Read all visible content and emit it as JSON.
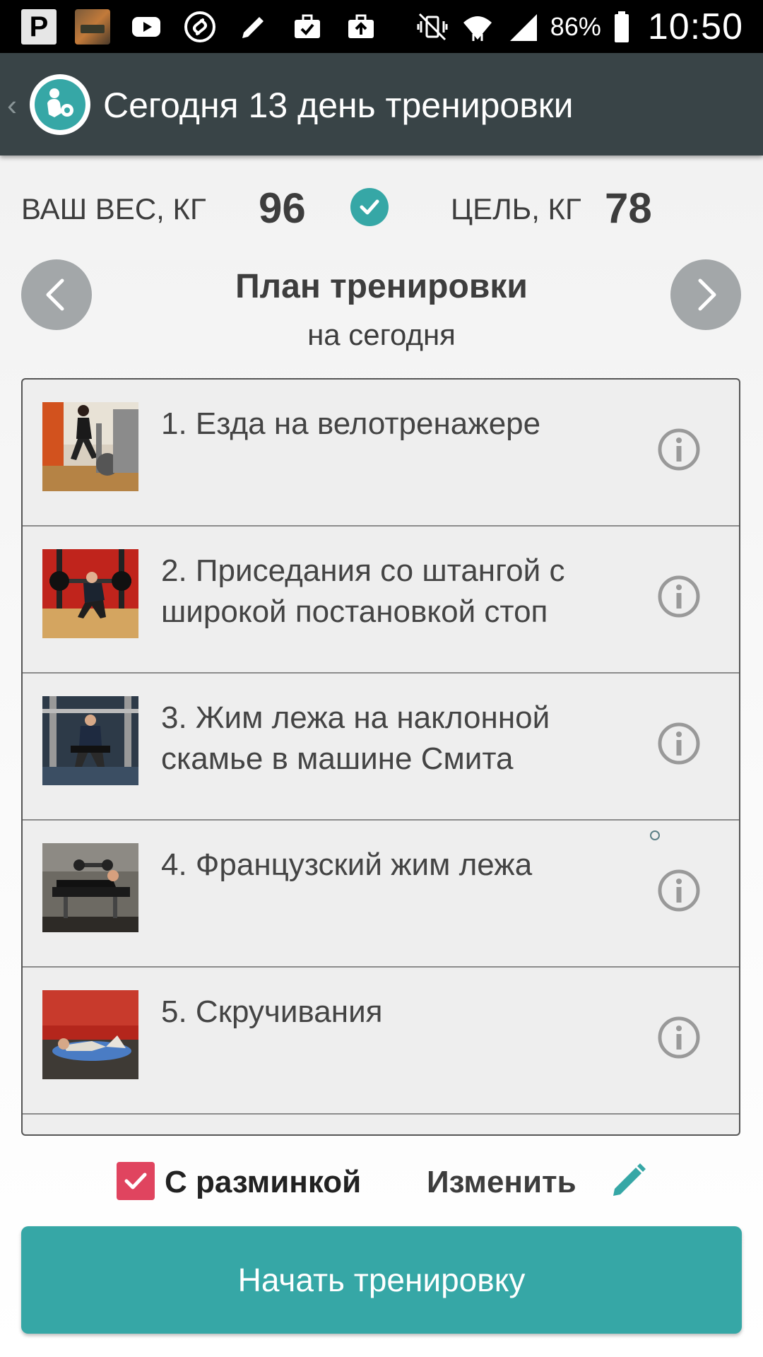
{
  "status_bar": {
    "battery": "86%",
    "time": "10:50",
    "left_icons": [
      "app-p-icon",
      "game-app-icon",
      "youtube-icon",
      "shazam-icon",
      "pencil-icon",
      "briefcase-check-icon",
      "briefcase-upload-icon"
    ],
    "right_icons": [
      "mute-vibrate-icon",
      "wifi-icon",
      "signal-icon",
      "battery-icon"
    ],
    "p_glyph": "P"
  },
  "app_bar": {
    "title": "Сегодня 13 день тренировки",
    "back_glyph": "‹",
    "background": "#394447"
  },
  "weight": {
    "current_label": "ВАШ ВЕС, КГ",
    "current_value": "96",
    "goal_label": "ЦЕЛЬ, КГ",
    "goal_value": "78"
  },
  "plan": {
    "title": "План тренировки",
    "subtitle": "на сегодня"
  },
  "exercises": [
    {
      "name": "1. Езда на велотренажере",
      "thumb": "exercise-bike-photo"
    },
    {
      "name": "2. Приседания со штангой с широкой постановкой стоп",
      "thumb": "barbell-squat-photo"
    },
    {
      "name": "3. Жим лежа на наклонной скамье в машине Смита",
      "thumb": "incline-bench-press-photo"
    },
    {
      "name": "4. Французский жим лежа",
      "thumb": "french-press-photo"
    },
    {
      "name": "5. Скручивания",
      "thumb": "crunches-photo"
    }
  ],
  "options": {
    "warmup_label": "С разминкой",
    "warmup_checked": true,
    "edit_label": "Изменить"
  },
  "start_button": {
    "label": "Начать тренировку"
  },
  "colors": {
    "accent": "#36a7a6",
    "checkbox": "#e0445f",
    "nav_button": "#a3a7a9",
    "text": "#3d3d3d"
  }
}
